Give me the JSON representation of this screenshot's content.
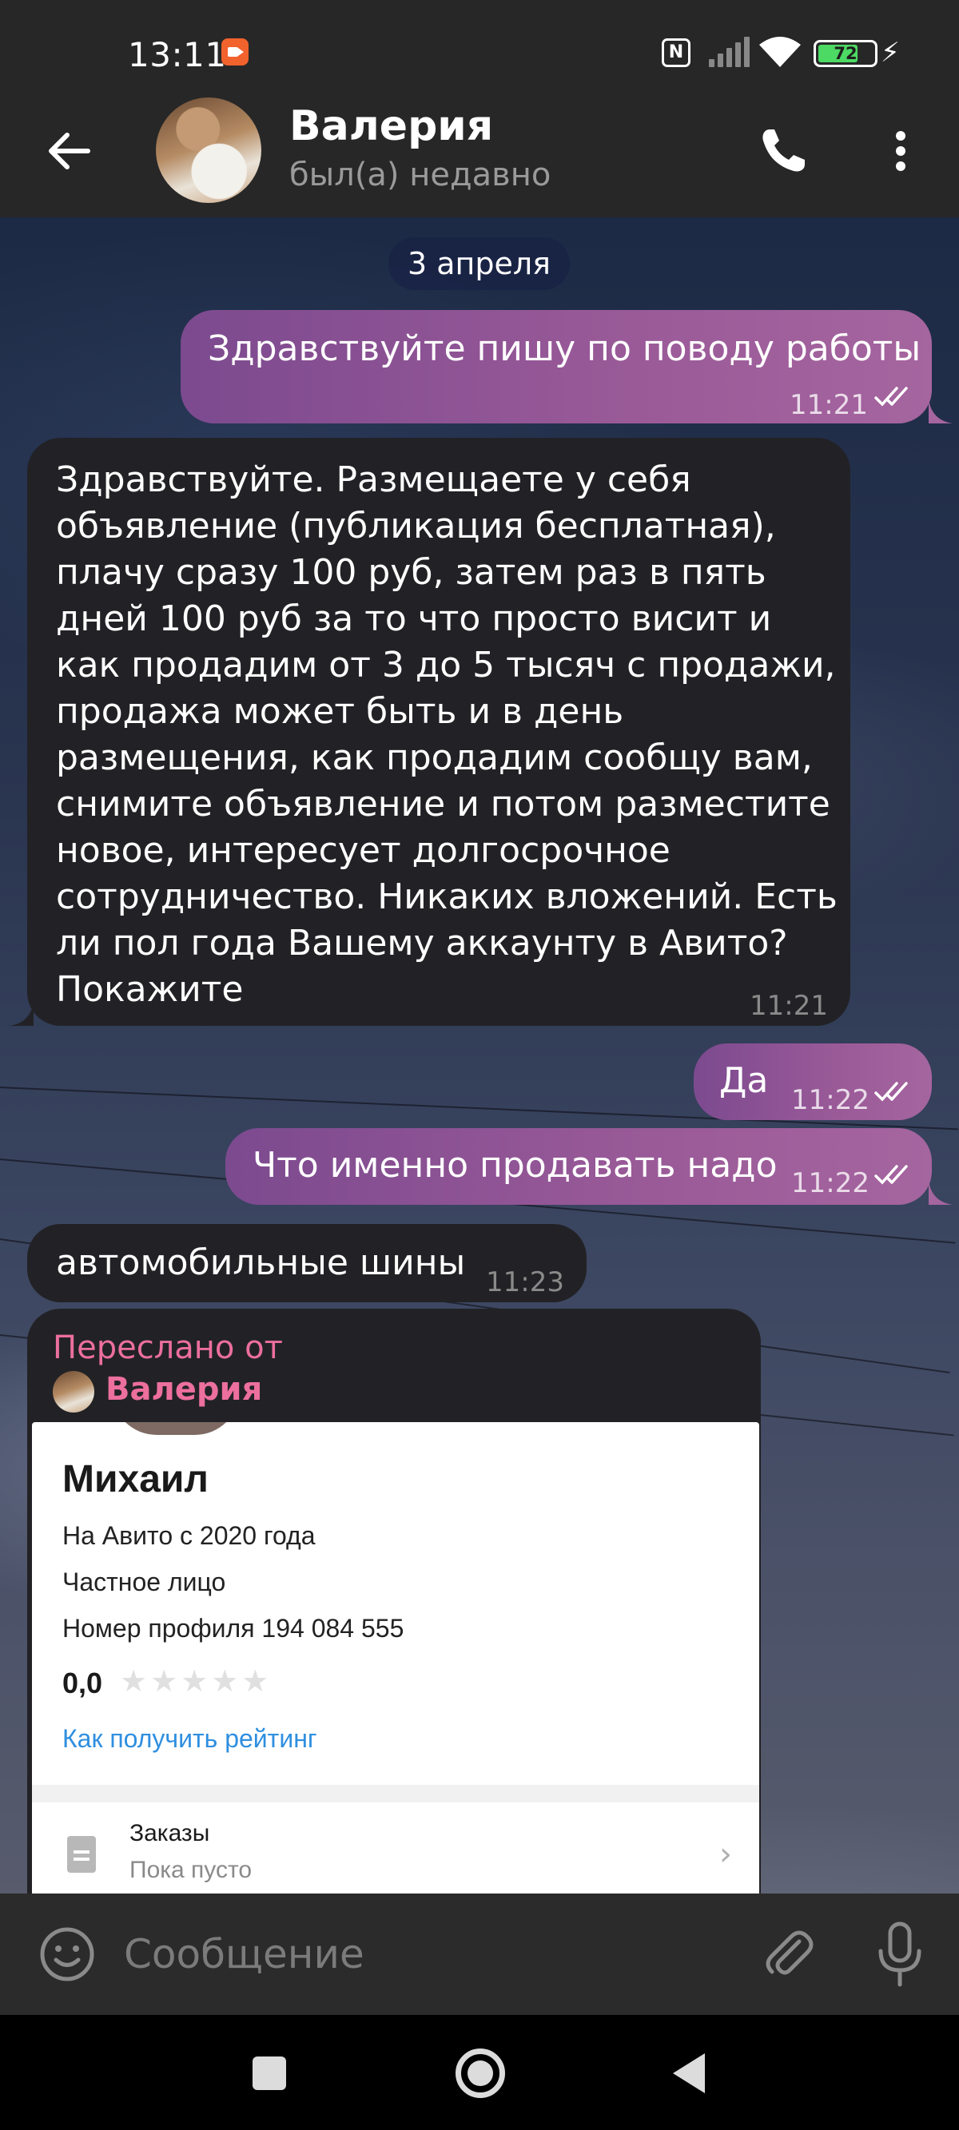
{
  "status_bar": {
    "time": "13:11",
    "battery": "72",
    "icons": [
      "screen-record-icon",
      "nfc-icon",
      "signal-icon",
      "wifi-icon",
      "battery-icon",
      "charging-icon"
    ]
  },
  "header": {
    "contact_name": "Валерия",
    "contact_status": "был(а) недавно",
    "icons": [
      "back-arrow-icon",
      "phone-icon",
      "more-vertical-icon"
    ]
  },
  "chat": {
    "date": "3 апреля",
    "messages": [
      {
        "direction": "out",
        "text": "Здравствуйте пишу по поводу работы",
        "time": "11:21",
        "read": true
      },
      {
        "direction": "in",
        "text": "Здравствуйте. Размещаете у себя объявление (публикация бесплатная), плачу сразу 100 руб, затем раз в пять дней 100 руб за то что просто висит и как продадим от 3 до 5 тысяч с продажи, продажа может быть и в день размещения, как продадим сообщу вам, снимите объявление и потом разместите новое, интересует долгосрочное сотрудничество. Никаких вложений. Есть ли пол года Вашему аккаунту в Авито? Покажите",
        "time": "11:21"
      },
      {
        "direction": "out",
        "text": "Да",
        "time": "11:22",
        "read": true
      },
      {
        "direction": "out",
        "text": "Что именно продавать надо",
        "time": "11:22",
        "read": true
      },
      {
        "direction": "in",
        "text": "автомобильные шины",
        "time": "11:23"
      }
    ],
    "forwarded": {
      "label": "Переслано от",
      "from": "Валерия",
      "screenshot": {
        "name": "Михаил",
        "since": "На Авито с 2020 года",
        "type": "Частное лицо",
        "profile_number": "Номер профиля 194 084 555",
        "rating": "0,0",
        "stars_filled": 0,
        "stars_total": 5,
        "rating_link": "Как получить рейтинг",
        "orders_title": "Заказы",
        "orders_status": "Пока пусто"
      }
    }
  },
  "input_bar": {
    "placeholder": "Сообщение",
    "icons": [
      "emoji-icon",
      "attach-icon",
      "microphone-icon"
    ]
  },
  "nav_bar": {
    "icons": [
      "recents-icon",
      "home-icon",
      "back-triangle-icon"
    ]
  },
  "colors": {
    "outgoing_bubble": "#9a5a98",
    "incoming_bubble": "#222226",
    "forward_accent": "#ec6f9c",
    "link": "#2f8fe0",
    "battery": "#4cd964"
  }
}
